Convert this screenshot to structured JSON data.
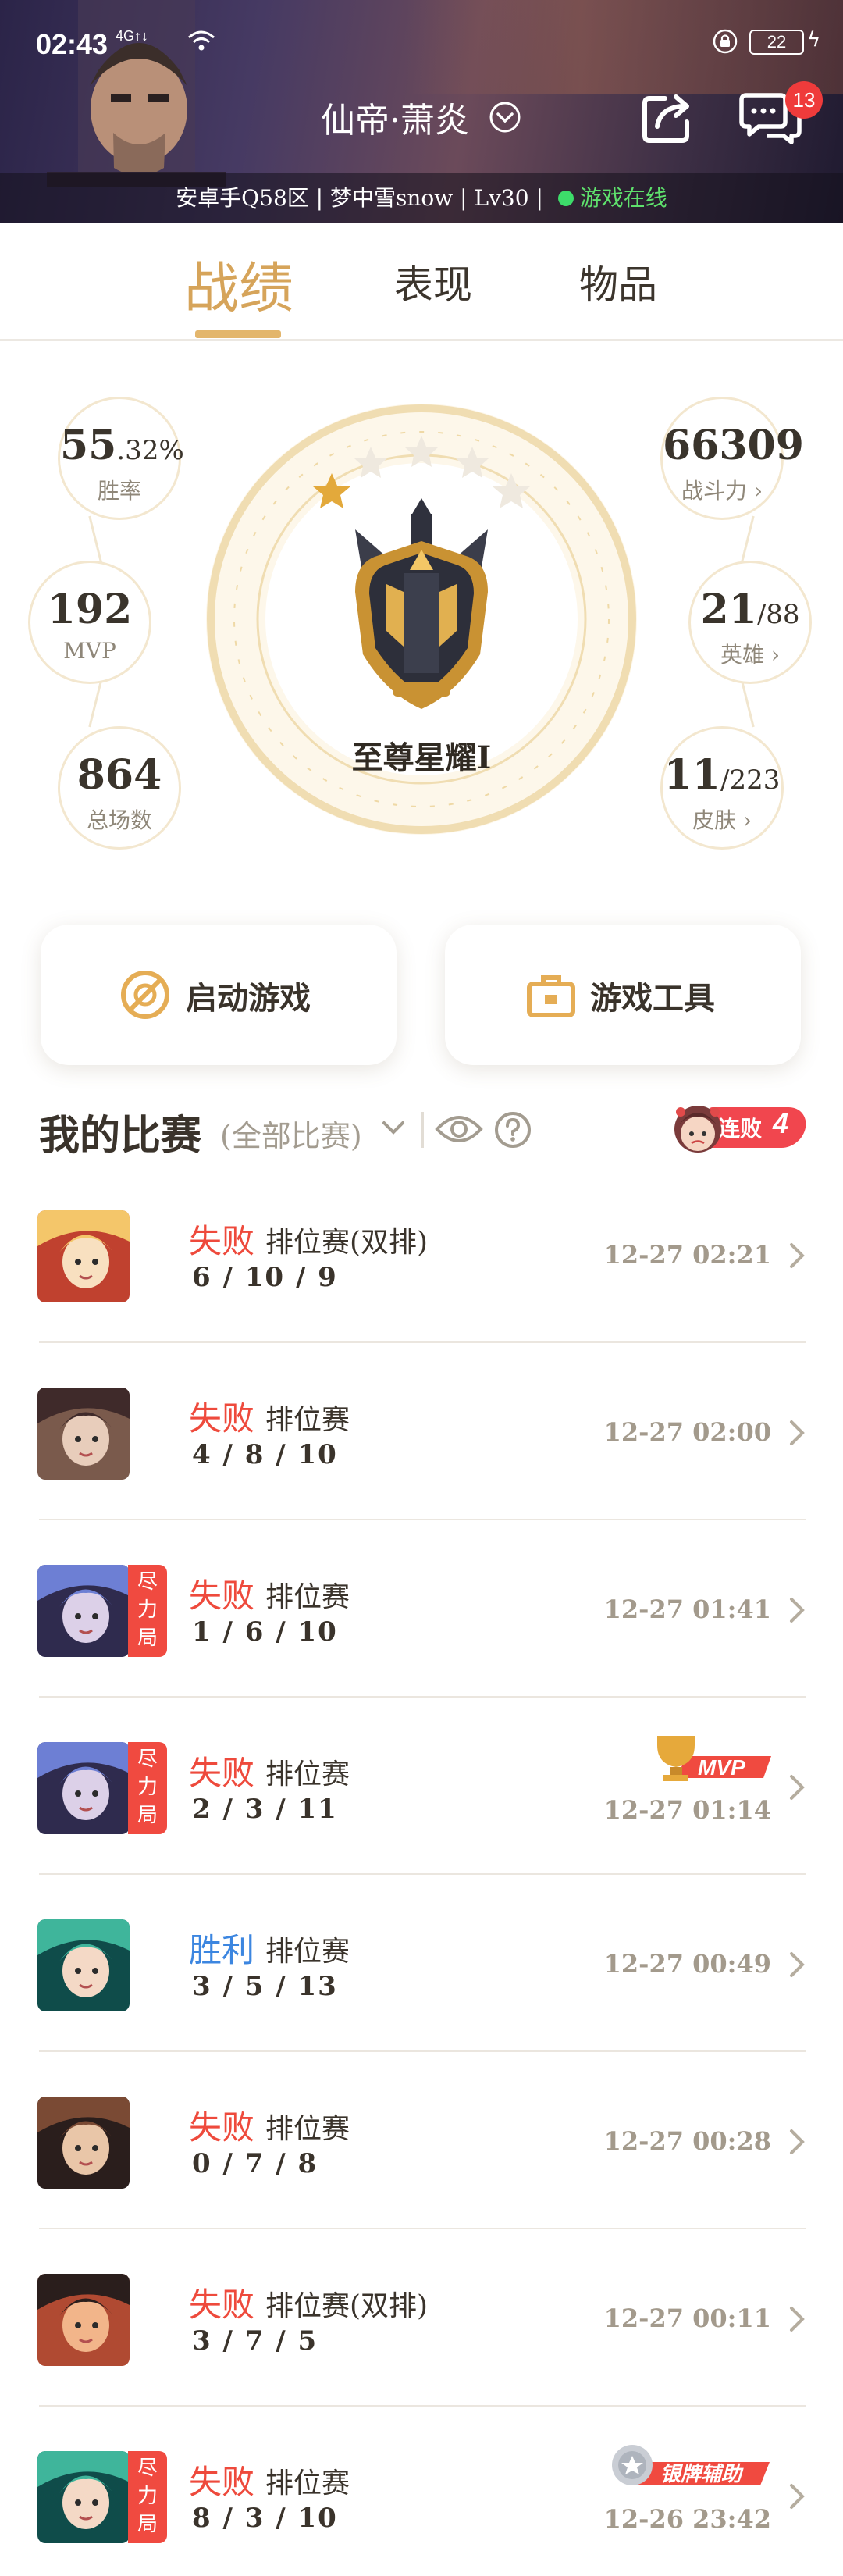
{
  "status_bar": {
    "time": "02:43",
    "signal": "4G↑↓",
    "battery": "22"
  },
  "header": {
    "player_name": "仙帝·萧炎",
    "unread_messages": "13",
    "server": "安卓手Q58区",
    "game_name": "梦中雪snow",
    "level": "Lv30",
    "online_status": "游戏在线",
    "separator": "|"
  },
  "tabs": [
    {
      "label": "战绩",
      "active": true
    },
    {
      "label": "表现",
      "active": false
    },
    {
      "label": "物品",
      "active": false
    }
  ],
  "stats": {
    "win_rate": {
      "value": "55",
      "decimal": ".32%",
      "label": "胜率"
    },
    "mvp": {
      "value": "192",
      "label": "MVP"
    },
    "total_games": {
      "value": "864",
      "label": "总场数"
    },
    "power": {
      "value": "66309",
      "label": "战斗力"
    },
    "heroes": {
      "value": "21",
      "total": "/88",
      "label": "英雄"
    },
    "skins": {
      "value": "11",
      "total": "/223",
      "label": "皮肤"
    },
    "rank": {
      "label": "至尊星耀I",
      "stars": 5,
      "stars_filled": 1
    }
  },
  "actions": {
    "launch_game": "启动游戏",
    "game_tools": "游戏工具"
  },
  "matches_section": {
    "title": "我的比赛",
    "filter": "(全部比赛)",
    "streak_label": "连败",
    "streak_count": "4"
  },
  "matches": [
    {
      "result": "失败",
      "mode": "排位赛(双排)",
      "kda": "6 / 10 / 9",
      "time": "12-27 02:21",
      "badge": "",
      "award": ""
    },
    {
      "result": "失败",
      "mode": "排位赛",
      "kda": "4 / 8 / 10",
      "time": "12-27 02:00",
      "badge": "",
      "award": ""
    },
    {
      "result": "失败",
      "mode": "排位赛",
      "kda": "1 / 6 / 10",
      "time": "12-27 01:41",
      "badge": "尽力局",
      "award": ""
    },
    {
      "result": "失败",
      "mode": "排位赛",
      "kda": "2 / 3 / 11",
      "time": "12-27 01:14",
      "badge": "尽力局",
      "award": "MVP"
    },
    {
      "result": "胜利",
      "mode": "排位赛",
      "kda": "3 / 5 / 13",
      "time": "12-27 00:49",
      "badge": "",
      "award": ""
    },
    {
      "result": "失败",
      "mode": "排位赛",
      "kda": "0 / 7 / 8",
      "time": "12-27 00:28",
      "badge": "",
      "award": ""
    },
    {
      "result": "失败",
      "mode": "排位赛(双排)",
      "kda": "3 / 7 / 5",
      "time": "12-27 00:11",
      "badge": "",
      "award": ""
    },
    {
      "result": "失败",
      "mode": "排位赛",
      "kda": "8 / 3 / 10",
      "time": "12-26 23:42",
      "badge": "尽力局",
      "award": "银牌辅助"
    }
  ],
  "colors": {
    "accent": "#d6a45a",
    "lose": "#ee4a3c",
    "win": "#3c86e0",
    "online": "#5ee06c",
    "badge": "#f04a40"
  }
}
